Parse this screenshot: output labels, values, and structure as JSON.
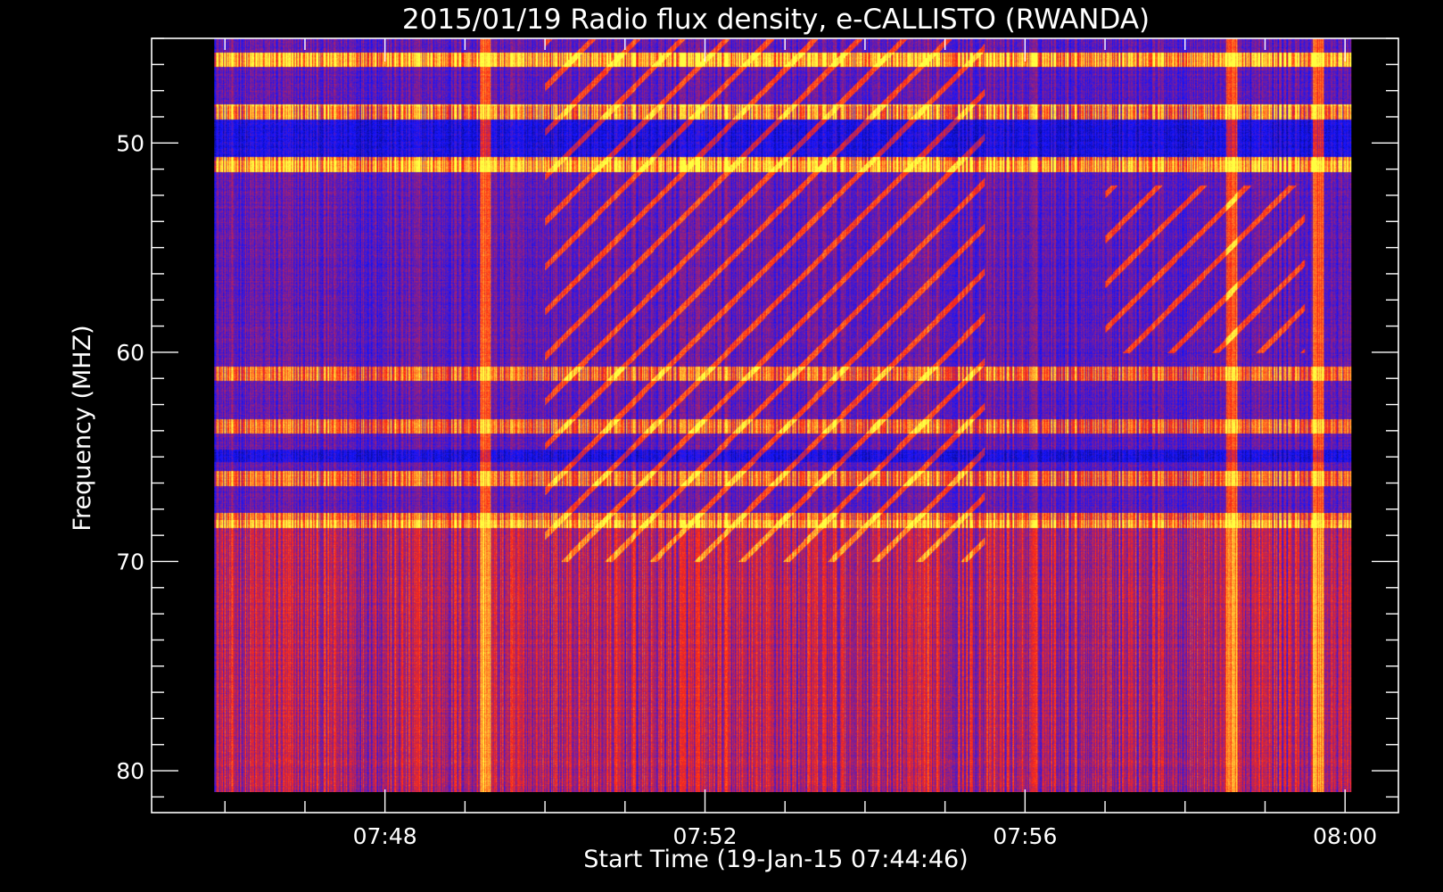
{
  "chart_data": {
    "type": "heatmap",
    "title": "2015/01/19  Radio flux density, e-CALLISTO (RWANDA)",
    "xlabel": "Start Time (19-Jan-15 07:44:46)",
    "ylabel": "Frequency (MHZ)",
    "x_axis": {
      "unit": "time (UT)",
      "range": [
        "07:45:05",
        "08:00:40"
      ],
      "ticks": [
        "07:48",
        "07:52",
        "07:56",
        "08:00"
      ],
      "minor_tick_interval_s": 60
    },
    "y_axis": {
      "unit": "MHz",
      "range": [
        45,
        82
      ],
      "reversed": true,
      "ticks": [
        50,
        60,
        70,
        80
      ],
      "minor_tick_interval": 1.25
    },
    "data_extent": {
      "time_start": "07:45:52",
      "time_end": "08:00:05",
      "freq_min": 45,
      "freq_max": 81
    },
    "colormap": [
      "#000000",
      "#1414ff",
      "#ff2a14",
      "#ffff40"
    ],
    "grid": false,
    "features": [
      {
        "type": "persistent interference band",
        "freq_mhz": 46
      },
      {
        "type": "persistent interference band",
        "freq_mhz": 48.5
      },
      {
        "type": "persistent interference band",
        "freq_mhz": 51
      },
      {
        "type": "interference band",
        "freq_mhz": 61
      },
      {
        "type": "interference band",
        "freq_mhz": 63.5
      },
      {
        "type": "interference band",
        "freq_mhz": 66
      },
      {
        "type": "interference band",
        "freq_mhz": 68
      },
      {
        "type": "vertical bright column",
        "time": "07:49:15"
      },
      {
        "type": "vertical bright column",
        "time": "07:58:35"
      },
      {
        "type": "vertical bright column",
        "time": "07:59:40"
      },
      {
        "type": "drifting emission streaks",
        "time_range": [
          "07:50:00",
          "07:55:30"
        ],
        "freq_range": [
          45,
          70
        ]
      },
      {
        "type": "drifting emission streaks",
        "time_range": [
          "07:57:00",
          "07:59:30"
        ],
        "freq_range": [
          52,
          60
        ]
      }
    ]
  }
}
